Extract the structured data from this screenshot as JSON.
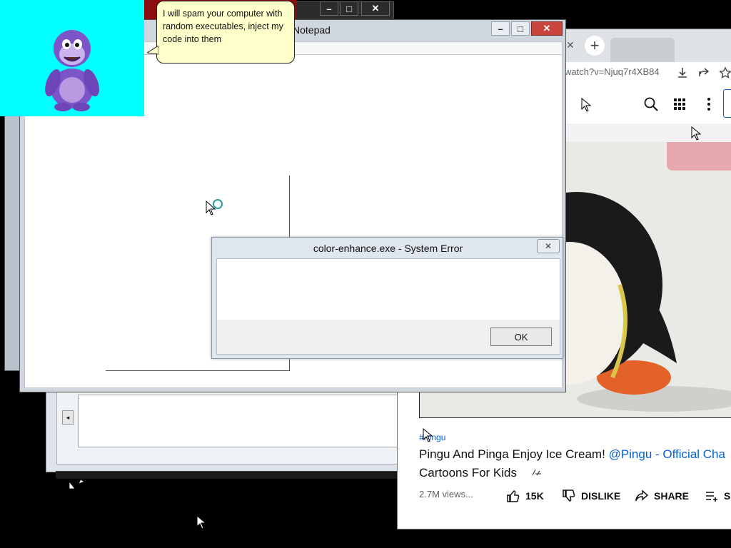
{
  "notepad": {
    "title": "Notepad"
  },
  "bonzi": {
    "speech": "I will spam your computer with random executables, inject my code into them"
  },
  "error_dialog": {
    "title": "color-enhance.exe - System Error",
    "ok_label": "OK"
  },
  "browser": {
    "url_fragment": "watch?v=Njuq7r4XB84",
    "new_tab": "+"
  },
  "youtube": {
    "hashtag": "#Pingu",
    "title_line1": "Pingu And Pinga Enjoy Ice Cream!",
    "channel": "@Pingu - Official Cha",
    "title_line2": "Cartoons For Kids",
    "views": "2.7M views...",
    "likes": "15K",
    "dislike_label": "DISLIKE",
    "share_label": "SHARE",
    "save_label": "S"
  },
  "colors": {
    "bonzi_bg": "#00ffff",
    "bonzi_purple": "#7e54c9",
    "speech_bg": "#ffffcc",
    "youtube_link": "#065fd4"
  }
}
